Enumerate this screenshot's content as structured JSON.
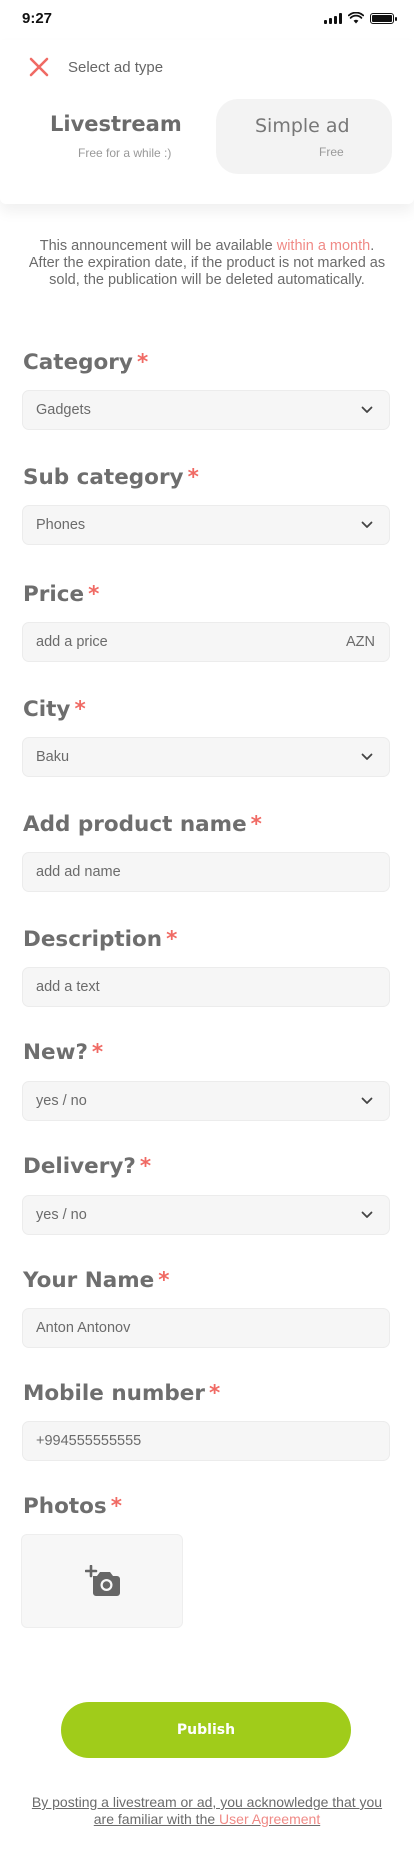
{
  "status_bar": {
    "time": "9:27"
  },
  "header": {
    "title": "Select ad type",
    "options": [
      {
        "name": "Livestream",
        "subtitle": "Free for a while :)"
      },
      {
        "name": "Simple ad",
        "subtitle": "Free"
      }
    ]
  },
  "notice": {
    "part1": "This announcement will be available ",
    "highlight": "within a month",
    "part2": ". After the expiration date, if the product is not marked as sold, the publication will be deleted automatically."
  },
  "required_mark": "*",
  "fields": {
    "category": {
      "label": "Category",
      "value": "Gadgets"
    },
    "subcategory": {
      "label": "Sub category",
      "value": "Phones"
    },
    "price": {
      "label": "Price",
      "placeholder": "add a price",
      "currency": "AZN"
    },
    "city": {
      "label": "City",
      "value": "Baku"
    },
    "product_name": {
      "label": "Add product name",
      "placeholder": "add ad name"
    },
    "description": {
      "label": "Description",
      "placeholder": "add a text"
    },
    "new": {
      "label": "New?",
      "value": "yes / no"
    },
    "delivery": {
      "label": "Delivery?",
      "value": "yes / no"
    },
    "your_name": {
      "label": "Your Name",
      "value": "Anton Antonov"
    },
    "mobile": {
      "label": "Mobile number",
      "value": "+994555555555"
    },
    "photos": {
      "label": "Photos"
    }
  },
  "publish_label": "Publish",
  "footer": {
    "text": "By posting a livestream or ad, you acknowledge that you are familiar with the ",
    "link": "User Agreement"
  },
  "colors": {
    "accent": "#a0cc1a",
    "highlight": "#f08a86",
    "required": "#f06a64"
  }
}
